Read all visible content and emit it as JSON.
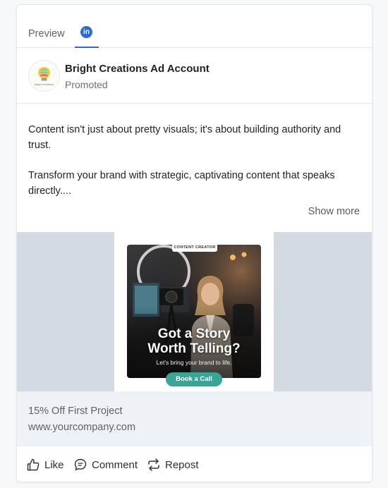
{
  "tabs": {
    "preview_label": "Preview",
    "linkedin_icon_text": "in",
    "active_tab": "linkedin"
  },
  "account": {
    "name": "Bright Creations Ad Account",
    "subtitle": "Promoted",
    "avatar_icon": "lightbulb-logo-icon"
  },
  "post": {
    "paragraph_1": "Content isn't just about pretty visuals; it's about building authority and trust.",
    "paragraph_2": "Transform your brand with strategic, captivating content that speaks directly....",
    "show_more_label": "Show more"
  },
  "creative": {
    "tag": "CONTENT CREATOR",
    "headline_line1": "Got a Story",
    "headline_line2": "Worth Telling?",
    "subline": "Let's bring your brand to life.",
    "cta_label": "Book a Call",
    "cta_color": "#3aa596"
  },
  "link": {
    "offer": "15% Off First Project",
    "url": "www.yourcompany.com"
  },
  "actions": {
    "like_label": "Like",
    "comment_label": "Comment",
    "repost_label": "Repost"
  },
  "colors": {
    "linkedin_blue": "#2d6bd0",
    "media_background": "#d4dae1",
    "link_strip_background": "#eef2f7"
  }
}
